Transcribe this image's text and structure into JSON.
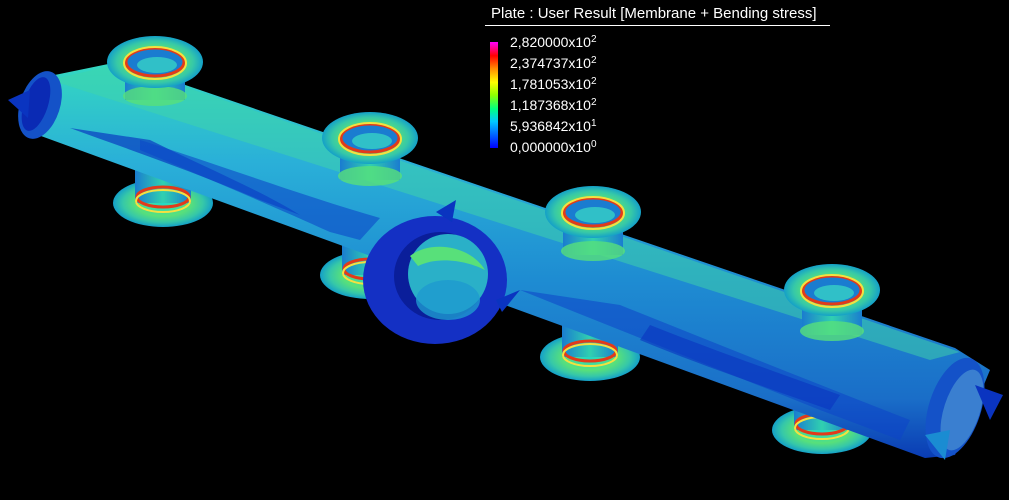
{
  "legend": {
    "title": "Plate : User Result [Membrane + Bending stress]",
    "levels": [
      {
        "mantissa": "2,820000x10",
        "exp": "2"
      },
      {
        "mantissa": "2,374737x10",
        "exp": "2"
      },
      {
        "mantissa": "1,781053x10",
        "exp": "2"
      },
      {
        "mantissa": "1,187368x10",
        "exp": "2"
      },
      {
        "mantissa": "5,936842x10",
        "exp": "1"
      },
      {
        "mantissa": "0,000000x10",
        "exp": "0"
      }
    ],
    "colors": [
      "#ff00ff",
      "#ff0000",
      "#ff8a00",
      "#ffff00",
      "#90ff00",
      "#00ff80",
      "#00c8ff",
      "#0060ff",
      "#0000ff"
    ]
  },
  "model": {
    "body_color": "#1e8cd2",
    "low_stress_color": "#0a2ec8",
    "mid_stress_color": "#43c8a0",
    "high_stress_color": "#e23a1a",
    "background": "#000000"
  }
}
